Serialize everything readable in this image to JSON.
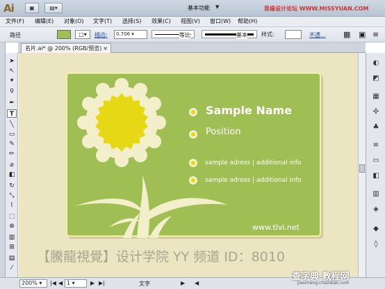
{
  "app": {
    "logo": "Ai",
    "workspace": "基本功能",
    "site": "思缘设计论坛  WWW.MISSYUAN.COM"
  },
  "menu": [
    "文件(F)",
    "编辑(E)",
    "对象(O)",
    "文字(T)",
    "选择(S)",
    "效果(C)",
    "视图(V)",
    "窗口(W)",
    "帮助(H)"
  ],
  "control": {
    "mode": "路径",
    "stroke_label": "描边:",
    "stroke_value": "0.706",
    "uniform": "等比",
    "basic": "基本",
    "style_label": "样式:",
    "opacity": "不透..."
  },
  "document": {
    "tab": "名片.ai* @ 200% (RGB/预览)",
    "close": "×"
  },
  "card": {
    "name": "Sample Name",
    "position": "Position",
    "address1": "sample adress | additional info",
    "address2": "sample adress | additional info",
    "url": "www.tlvi.net"
  },
  "watermark": "【騰龍視覺】设计学院  YY 频道 ID：8010",
  "status": {
    "zoom": "200%",
    "page": "1",
    "mode": "文字"
  },
  "brand": {
    "main": "查字典 教程网",
    "sub": "jiaocheng.chazidian.com"
  },
  "colors": {
    "card_green": "#9fbe53",
    "canvas_bg": "#ece5c1",
    "flower_yellow": "#e6d814",
    "cream": "#f3efcb"
  }
}
